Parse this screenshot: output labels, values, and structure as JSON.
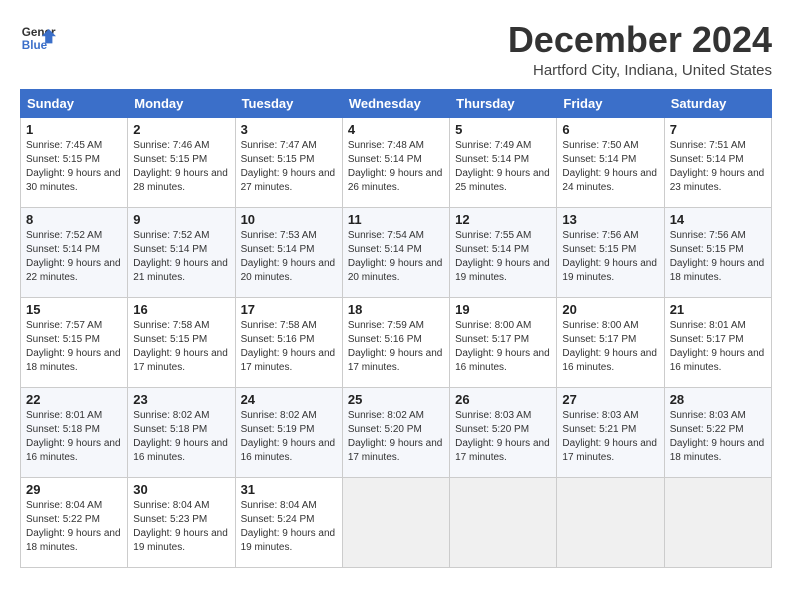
{
  "header": {
    "logo_line1": "General",
    "logo_line2": "Blue",
    "title": "December 2024",
    "location": "Hartford City, Indiana, United States"
  },
  "calendar": {
    "weekdays": [
      "Sunday",
      "Monday",
      "Tuesday",
      "Wednesday",
      "Thursday",
      "Friday",
      "Saturday"
    ],
    "weeks": [
      [
        {
          "day": "1",
          "info": "Sunrise: 7:45 AM\nSunset: 5:15 PM\nDaylight: 9 hours and 30 minutes."
        },
        {
          "day": "2",
          "info": "Sunrise: 7:46 AM\nSunset: 5:15 PM\nDaylight: 9 hours and 28 minutes."
        },
        {
          "day": "3",
          "info": "Sunrise: 7:47 AM\nSunset: 5:15 PM\nDaylight: 9 hours and 27 minutes."
        },
        {
          "day": "4",
          "info": "Sunrise: 7:48 AM\nSunset: 5:14 PM\nDaylight: 9 hours and 26 minutes."
        },
        {
          "day": "5",
          "info": "Sunrise: 7:49 AM\nSunset: 5:14 PM\nDaylight: 9 hours and 25 minutes."
        },
        {
          "day": "6",
          "info": "Sunrise: 7:50 AM\nSunset: 5:14 PM\nDaylight: 9 hours and 24 minutes."
        },
        {
          "day": "7",
          "info": "Sunrise: 7:51 AM\nSunset: 5:14 PM\nDaylight: 9 hours and 23 minutes."
        }
      ],
      [
        {
          "day": "8",
          "info": "Sunrise: 7:52 AM\nSunset: 5:14 PM\nDaylight: 9 hours and 22 minutes."
        },
        {
          "day": "9",
          "info": "Sunrise: 7:52 AM\nSunset: 5:14 PM\nDaylight: 9 hours and 21 minutes."
        },
        {
          "day": "10",
          "info": "Sunrise: 7:53 AM\nSunset: 5:14 PM\nDaylight: 9 hours and 20 minutes."
        },
        {
          "day": "11",
          "info": "Sunrise: 7:54 AM\nSunset: 5:14 PM\nDaylight: 9 hours and 20 minutes."
        },
        {
          "day": "12",
          "info": "Sunrise: 7:55 AM\nSunset: 5:14 PM\nDaylight: 9 hours and 19 minutes."
        },
        {
          "day": "13",
          "info": "Sunrise: 7:56 AM\nSunset: 5:15 PM\nDaylight: 9 hours and 19 minutes."
        },
        {
          "day": "14",
          "info": "Sunrise: 7:56 AM\nSunset: 5:15 PM\nDaylight: 9 hours and 18 minutes."
        }
      ],
      [
        {
          "day": "15",
          "info": "Sunrise: 7:57 AM\nSunset: 5:15 PM\nDaylight: 9 hours and 18 minutes."
        },
        {
          "day": "16",
          "info": "Sunrise: 7:58 AM\nSunset: 5:15 PM\nDaylight: 9 hours and 17 minutes."
        },
        {
          "day": "17",
          "info": "Sunrise: 7:58 AM\nSunset: 5:16 PM\nDaylight: 9 hours and 17 minutes."
        },
        {
          "day": "18",
          "info": "Sunrise: 7:59 AM\nSunset: 5:16 PM\nDaylight: 9 hours and 17 minutes."
        },
        {
          "day": "19",
          "info": "Sunrise: 8:00 AM\nSunset: 5:17 PM\nDaylight: 9 hours and 16 minutes."
        },
        {
          "day": "20",
          "info": "Sunrise: 8:00 AM\nSunset: 5:17 PM\nDaylight: 9 hours and 16 minutes."
        },
        {
          "day": "21",
          "info": "Sunrise: 8:01 AM\nSunset: 5:17 PM\nDaylight: 9 hours and 16 minutes."
        }
      ],
      [
        {
          "day": "22",
          "info": "Sunrise: 8:01 AM\nSunset: 5:18 PM\nDaylight: 9 hours and 16 minutes."
        },
        {
          "day": "23",
          "info": "Sunrise: 8:02 AM\nSunset: 5:18 PM\nDaylight: 9 hours and 16 minutes."
        },
        {
          "day": "24",
          "info": "Sunrise: 8:02 AM\nSunset: 5:19 PM\nDaylight: 9 hours and 16 minutes."
        },
        {
          "day": "25",
          "info": "Sunrise: 8:02 AM\nSunset: 5:20 PM\nDaylight: 9 hours and 17 minutes."
        },
        {
          "day": "26",
          "info": "Sunrise: 8:03 AM\nSunset: 5:20 PM\nDaylight: 9 hours and 17 minutes."
        },
        {
          "day": "27",
          "info": "Sunrise: 8:03 AM\nSunset: 5:21 PM\nDaylight: 9 hours and 17 minutes."
        },
        {
          "day": "28",
          "info": "Sunrise: 8:03 AM\nSunset: 5:22 PM\nDaylight: 9 hours and 18 minutes."
        }
      ],
      [
        {
          "day": "29",
          "info": "Sunrise: 8:04 AM\nSunset: 5:22 PM\nDaylight: 9 hours and 18 minutes."
        },
        {
          "day": "30",
          "info": "Sunrise: 8:04 AM\nSunset: 5:23 PM\nDaylight: 9 hours and 19 minutes."
        },
        {
          "day": "31",
          "info": "Sunrise: 8:04 AM\nSunset: 5:24 PM\nDaylight: 9 hours and 19 minutes."
        },
        null,
        null,
        null,
        null
      ]
    ]
  }
}
